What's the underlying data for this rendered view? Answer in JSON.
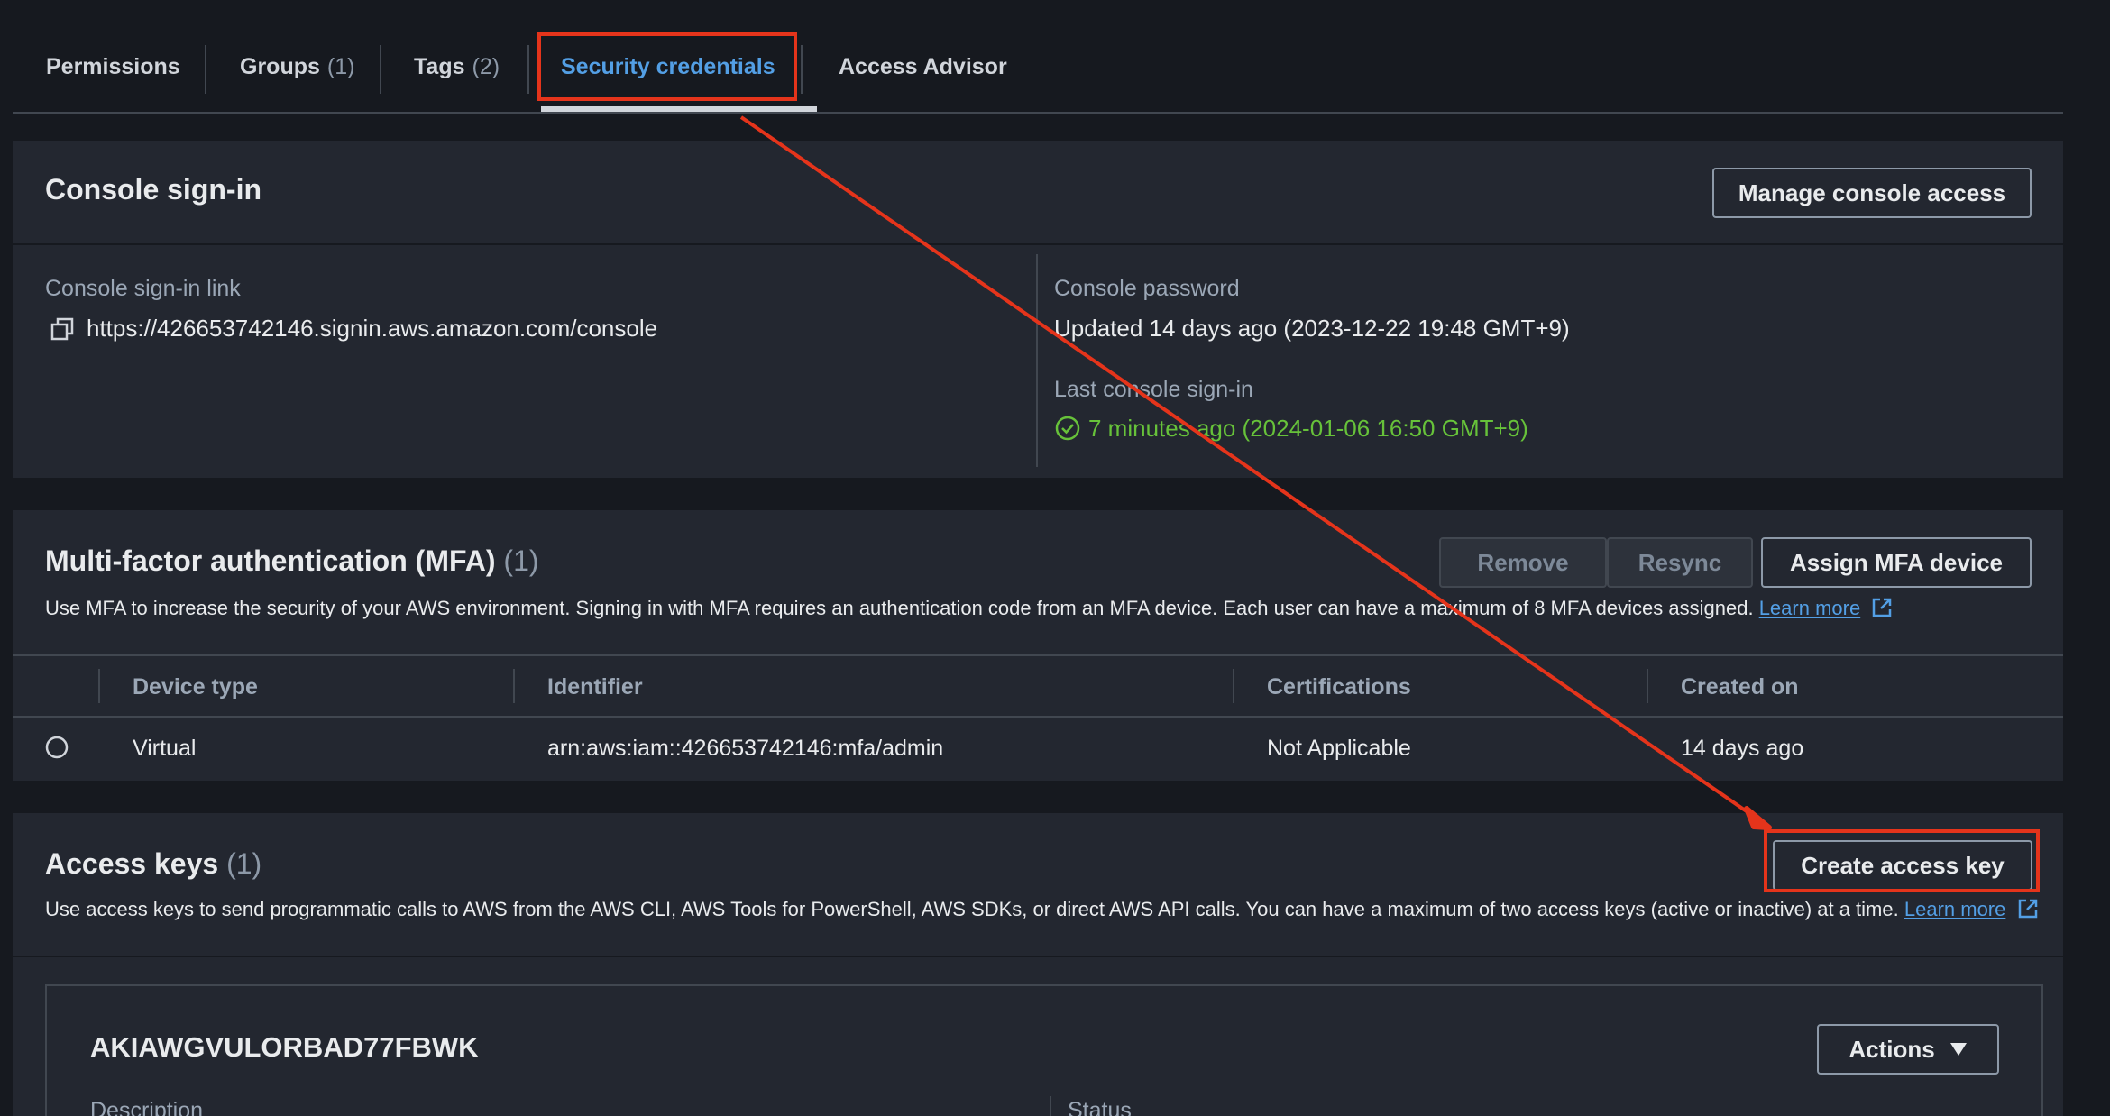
{
  "tabs": [
    {
      "label": "Permissions",
      "count": ""
    },
    {
      "label": "Groups",
      "count": "(1)"
    },
    {
      "label": "Tags",
      "count": "(2)"
    },
    {
      "label": "Security credentials",
      "count": ""
    },
    {
      "label": "Access Advisor",
      "count": ""
    }
  ],
  "console_signin": {
    "title": "Console sign-in",
    "manage_button": "Manage console access",
    "link_label": "Console sign-in link",
    "link_value": "https://426653742146.signin.aws.amazon.com/console",
    "password_label": "Console password",
    "password_value": "Updated 14 days ago (2023-12-22 19:48 GMT+9)",
    "last_signin_label": "Last console sign-in",
    "last_signin_value": "7 minutes ago (2024-01-06 16:50 GMT+9)"
  },
  "mfa": {
    "title": "Multi-factor authentication (MFA)",
    "count": "(1)",
    "remove_button": "Remove",
    "resync_button": "Resync",
    "assign_button": "Assign MFA device",
    "description": "Use MFA to increase the security of your AWS environment. Signing in with MFA requires an authentication code from an MFA device. Each user can have a maximum of 8 MFA devices assigned.",
    "learn_more": "Learn more",
    "columns": [
      "Device type",
      "Identifier",
      "Certifications",
      "Created on"
    ],
    "rows": [
      {
        "device_type": "Virtual",
        "identifier": "arn:aws:iam::426653742146:mfa/admin",
        "certifications": "Not Applicable",
        "created_on": "14 days ago"
      }
    ]
  },
  "access_keys": {
    "title": "Access keys",
    "count": "(1)",
    "create_button": "Create access key",
    "description": "Use access keys to send programmatic calls to AWS from the AWS CLI, AWS Tools for PowerShell, AWS SDKs, or direct AWS API calls. You can have a maximum of two access keys (active or inactive) at a time.",
    "learn_more": "Learn more",
    "key_id": "AKIAWGVULORBAD77FBWK",
    "actions_button": "Actions",
    "description_label": "Description",
    "status_label": "Status"
  },
  "colors": {
    "accent": "#539fe5",
    "annotation": "#e5341b",
    "success": "#67c23a"
  }
}
